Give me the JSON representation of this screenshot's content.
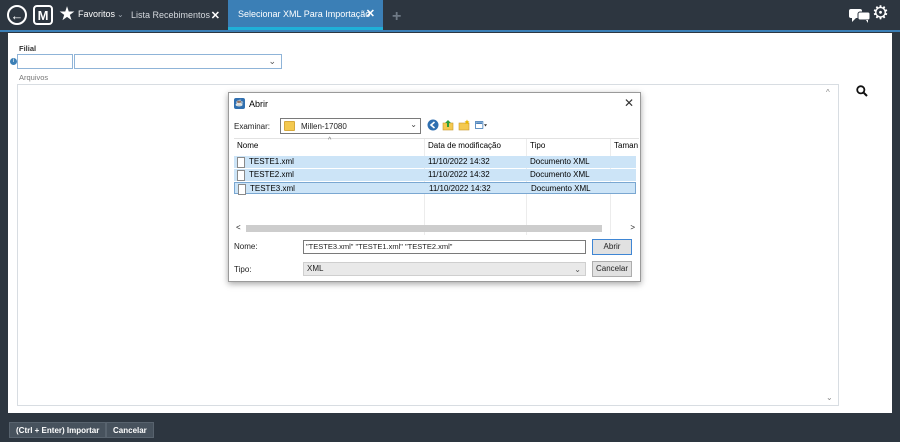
{
  "topbar": {
    "favorites_label": "Favoritos",
    "favorites_caret": "⌄",
    "tabs": [
      {
        "label": "Lista Recebimentos",
        "close": "✕"
      },
      {
        "label": "Selecionar XML Para Importação",
        "close": "✕"
      }
    ],
    "add_tab": "+",
    "icons": [
      "back-icon",
      "m-logo-icon",
      "star-icon",
      "chat-icon",
      "gear-icon"
    ]
  },
  "form": {
    "filial_label": "Filial",
    "filial_code_value": "",
    "filial_select_value": "",
    "arquivos_label": "Arquivos"
  },
  "dialog": {
    "title": "Abrir",
    "close": "✕",
    "look_in_label": "Examinar:",
    "look_in_value": "Millen-17080",
    "columns": [
      "Nome",
      "Data de modificação",
      "Tipo",
      "Taman"
    ],
    "files": [
      {
        "name": "TESTE1.xml",
        "modified": "11/10/2022 14:32",
        "type": "Documento XML"
      },
      {
        "name": "TESTE2.xml",
        "modified": "11/10/2022 14:32",
        "type": "Documento XML"
      },
      {
        "name": "TESTE3.xml",
        "modified": "11/10/2022 14:32",
        "type": "Documento XML"
      }
    ],
    "name_label": "Nome:",
    "name_value": "\"TESTE3.xml\" \"TESTE1.xml\" \"TESTE2.xml\"",
    "type_label": "Tipo:",
    "type_value": "XML",
    "open_button": "Abrir",
    "cancel_button": "Cancelar"
  },
  "bottombar": {
    "import_button": "(Ctrl + Enter) Importar",
    "cancel_button": "Cancelar"
  },
  "colors": {
    "bar_bg": "#2d3640",
    "active_tab": "#3b7fb6",
    "selection": "#cce4f7"
  }
}
